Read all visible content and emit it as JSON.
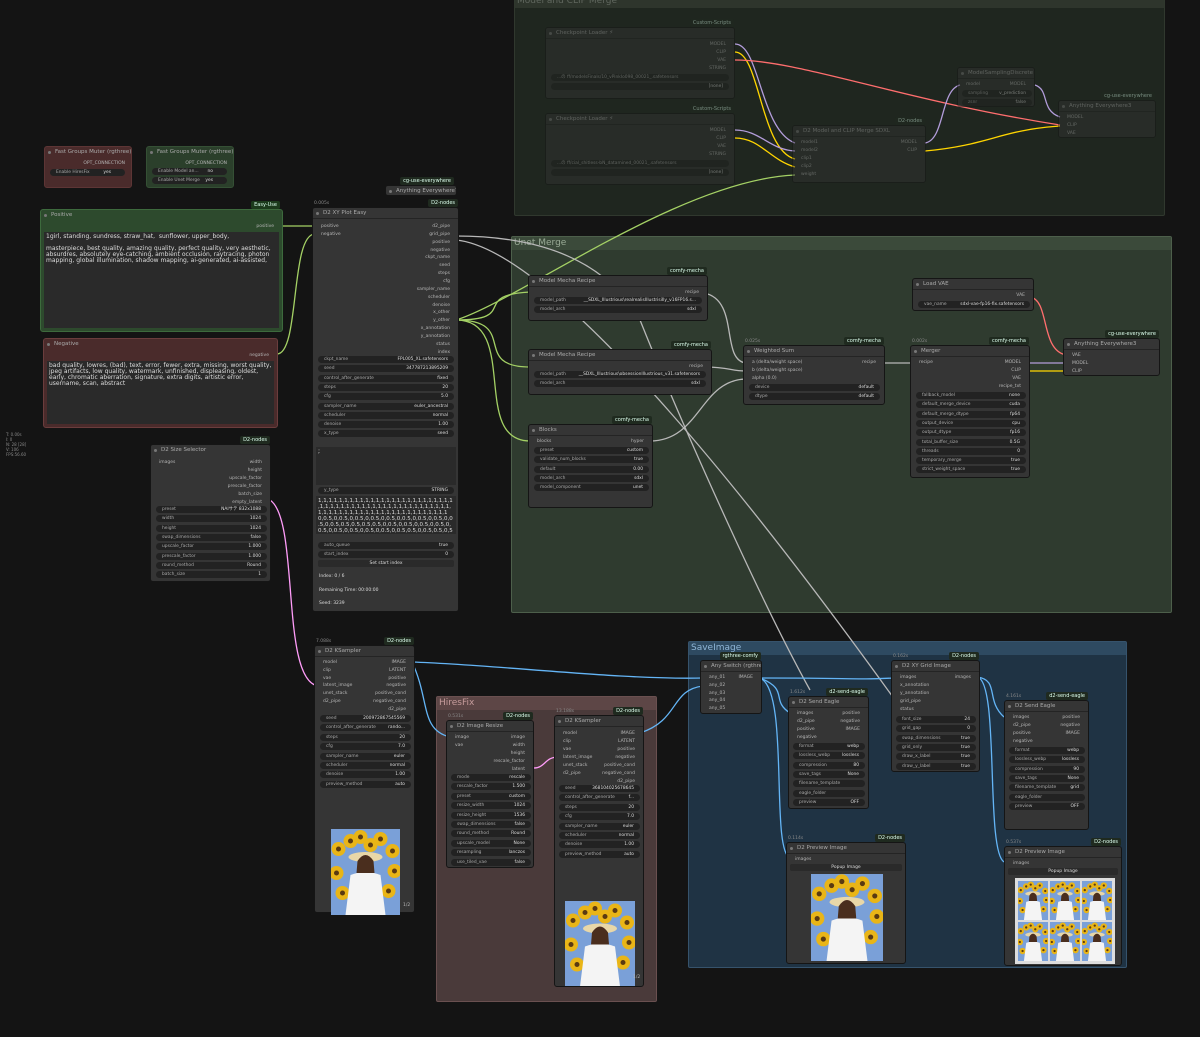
{
  "groups": {
    "merge": "Model and CLIP Merge",
    "unet": "Unet Merge",
    "save": "SaveImage",
    "hires": "HiresFix"
  },
  "info": [
    "T: 0.00s",
    "I: 0",
    "N: 28 [28]",
    "V: 106",
    "FPS:56.60"
  ],
  "muter1": {
    "title": "Fast Groups Muter (rgthree)",
    "opt": "OPT_CONNECTION",
    "row_label": "Enable HiresFix",
    "row_val": "yes"
  },
  "muter2": {
    "title": "Fast Groups Muter (rgthree)",
    "opt": "OPT_CONNECTION",
    "row1_label": "Enable Model an...",
    "row1_val": "no",
    "row2_label": "Enable Unet Merge",
    "row2_val": "yes"
  },
  "positive": {
    "title": "Positive",
    "badge": "Easy-Use",
    "out": "positive",
    "text": "1girl, standing, sundress, straw_hat,  sunflower, upper_body,\n\nmasterpiece, best quality, amazing quality, perfect quality, very aesthetic, absurdres, absolutely eye-catching, ambient occlusion, raytracing, photon mapping, global illumination, shadow mapping, ai-generated, ai-assisted,"
  },
  "negative": {
    "title": "Negative",
    "out": "negative",
    "text": "bad quality, lowres, (bad), text, error, fewer, extra, missing, worst quality, jpeg artifacts, low quality, watermark, unfinished, displeasing, oldest, early, chromatic aberration, signature, extra digits, artistic error, username, scan, abstract"
  },
  "sizesel": {
    "title": "D2 Size Selector",
    "badge": "D2-nodes",
    "in": "images",
    "outs": [
      "width",
      "height",
      "upscale_factor",
      "prescale_factor",
      "batch_size",
      "empty_latent"
    ],
    "widgets": [
      [
        "preset",
        "NAIサテ 832x1088"
      ],
      [
        "width",
        "1024"
      ],
      [
        "height",
        "1024"
      ],
      [
        "swap_dimensions",
        "false"
      ],
      [
        "upscale_factor",
        "1.000"
      ],
      [
        "prescale_factor",
        "1.000"
      ],
      [
        "round_method",
        "Round"
      ],
      [
        "batch_size",
        "1"
      ]
    ]
  },
  "anything1": {
    "title": "Anything Everywhere?",
    "badge": "cg-use-everywhere"
  },
  "xyplot": {
    "title": "D2 XY Plot Easy",
    "badge": "D2-nodes",
    "time": "0.005s",
    "ins": [
      "positive",
      "negative"
    ],
    "outs": [
      "d2_pipe",
      "grid_pipe",
      "positive",
      "negative",
      "ckpt_name",
      "seed",
      "steps",
      "cfg",
      "sampler_name",
      "scheduler",
      "denoise",
      "x_other",
      "y_other",
      "x_annotation",
      "y_annotation",
      "status",
      "index"
    ],
    "widgets": [
      [
        "ckpt_name",
        "FPL005_XL.safetensors"
      ],
      [
        "seed",
        "347787213895209"
      ],
      [
        "control_after_generate",
        "fixed"
      ],
      [
        "steps",
        "20"
      ],
      [
        "cfg",
        "5.0"
      ],
      [
        "sampler_name",
        "euler_ancestral"
      ],
      [
        "scheduler",
        "normal"
      ],
      [
        "denoise",
        "1.00"
      ],
      [
        "x_type",
        "seed"
      ]
    ],
    "x_value": ";",
    "y_type": [
      "y_type",
      "STRING"
    ],
    "y_value": "1,1,1,1,1,1,1,1,1,1,1,1,1,1,1,1,1,1,1,1,1,1,1,1,1,1,1,1,1,1,1,1,1,1,1,1,1,1,1,1,1,1,1,1,1,1,1,1,1,1,1,1,1,1,1,1,1,1,1,1,1,1,1,1,1,1,1,1,1,1,1,1,1,1,1,1\n0,0.5,0,0.5,0,0.5,0,0.5,0,0.5,0,0.5,0,0.5,0,0.5,0,0.5,0,0.5,0.5,0.5,0.5,0.5,0,0.5,0,0.5,0,0.5,0,0.5,0,0.5,0,0.5,0,0.5,0,0.5,0,0.5,0,0.5,0.5,0,0.5,0.5,0,5,0,5,0,5,0,0,0,5,0,0,5,0,0,5,0,0,5,0,0,5,0,3",
    "auto_queue": [
      "auto_queue",
      "true"
    ],
    "start_index": [
      "start_index",
      "0"
    ],
    "set_btn": "Set start index",
    "index": "Index: 0 / 6",
    "remaining": "Remaining Time: 00:00:00",
    "seed_info": "Seed: 3239"
  },
  "ksampler1": {
    "title": "D2 KSampler",
    "badge": "D2-nodes",
    "time": "7.088s",
    "ins": [
      "model",
      "clip",
      "vae",
      "latent_image",
      "unet_stack",
      "d2_pipe"
    ],
    "outs": [
      "IMAGE",
      "LATENT",
      "positive",
      "negative",
      "positive_cond",
      "negative_cond",
      "d2_pipe"
    ],
    "widgets": [
      [
        "seed",
        "200972867545569"
      ],
      [
        "control_after_generate",
        "rando..."
      ],
      [
        "steps",
        "20"
      ],
      [
        "cfg",
        "7.0"
      ],
      [
        "sampler_name",
        "euler"
      ],
      [
        "scheduler",
        "normal"
      ],
      [
        "denoise",
        "1.00"
      ],
      [
        "preview_method",
        "auto"
      ]
    ],
    "pager": "1/2"
  },
  "resize": {
    "title": "D2 Image Resize",
    "badge": "D2-nodes",
    "time": "0.531s",
    "ins": [
      "image",
      "vae"
    ],
    "outs": [
      "image",
      "width",
      "height",
      "rescale_factor",
      "latent"
    ],
    "widgets": [
      [
        "mode",
        "rescale"
      ],
      [
        "rescale_factor",
        "1.500"
      ],
      [
        "preset",
        "custom"
      ],
      [
        "resize_width",
        "1024"
      ],
      [
        "resize_height",
        "1536"
      ],
      [
        "swap_dimensions",
        "false"
      ],
      [
        "round_method",
        "Round"
      ],
      [
        "upscale_model",
        "None"
      ],
      [
        "resampling",
        "lanczos"
      ],
      [
        "use_tiled_vae",
        "false"
      ]
    ]
  },
  "ksampler2": {
    "title": "D2 KSampler",
    "badge": "D2-nodes",
    "time": "13.188s",
    "ins": [
      "model",
      "clip",
      "vae",
      "latent_image",
      "unet_stack",
      "d2_pipe"
    ],
    "outs": [
      "IMAGE",
      "LATENT",
      "positive",
      "negative",
      "positive_cond",
      "negative_cond",
      "d2_pipe"
    ],
    "widgets": [
      [
        "seed",
        "368104025678645"
      ],
      [
        "control_after_generate",
        "f..."
      ],
      [
        "steps",
        "20"
      ],
      [
        "cfg",
        "7.0"
      ],
      [
        "sampler_name",
        "euler"
      ],
      [
        "scheduler",
        "normal"
      ],
      [
        "denoise",
        "1.00"
      ],
      [
        "preview_method",
        "auto"
      ]
    ],
    "pager": "1/2"
  },
  "ckpt1": {
    "title": "Checkpoint Loader ⚡",
    "badge": "Custom-Scripts",
    "outs": [
      "MODEL",
      "CLIP",
      "VAE",
      "STRING"
    ],
    "ckpt": "...の ff/modelsFinals/10_vPinkIo098_00021_.safetensors",
    "extra": "[none]"
  },
  "ckpt2": {
    "title": "Checkpoint Loader ⚡",
    "badge": "Custom-Scripts",
    "outs": [
      "MODEL",
      "CLIP",
      "VAE",
      "STRING"
    ],
    "ckpt": "...の ff/cial_shitless-bN_datamined_00021_.safetensors",
    "extra": "[none]"
  },
  "msd": {
    "title": "ModelSamplingDiscrete",
    "ins": [
      "model"
    ],
    "outs": [
      "MODEL"
    ],
    "w1": [
      "sampling",
      "v_prediction"
    ],
    "w2": [
      "zsnr",
      "false"
    ]
  },
  "d2merge": {
    "title": "D2 Model and CLIP Merge SDXL",
    "badge": "D2-nodes",
    "ins": [
      "model1",
      "model2",
      "clip1",
      "clip2",
      "weight"
    ],
    "outs": [
      "MODEL",
      "CLIP"
    ]
  },
  "anything2": {
    "title": "Anything Everywhere3",
    "badge": "cg-use-everywhere",
    "ins": [
      "MODEL",
      "CLIP",
      "VAE"
    ]
  },
  "mm1": {
    "title": "Model Mecha Recipe",
    "badge": "comfy-mecha",
    "out": "recipe",
    "w": [
      [
        "model_path",
        "__SDXL_Illustrious\\realrealisIllustrisiIly_v16FP16.s..."
      ],
      [
        "model_arch",
        "sdxl"
      ]
    ]
  },
  "mm2": {
    "title": "Model Mecha Recipe",
    "badge": "comfy-mecha",
    "out": "recipe",
    "w": [
      [
        "model_path",
        "__SDXL_Illustrious\\obsessionIllustrious_v31.safetensors"
      ],
      [
        "model_arch",
        "sdxl"
      ]
    ]
  },
  "blocks": {
    "title": "Blocks",
    "badge": "comfy-mecha",
    "in": "blocks",
    "out": "hyper",
    "w": [
      [
        "preset",
        "custom"
      ],
      [
        "validate_num_blocks",
        "true"
      ],
      [
        "default",
        "0.00"
      ],
      [
        "model_arch",
        "sdxl"
      ],
      [
        "model_component",
        "unet"
      ]
    ]
  },
  "wsum": {
    "title": "Weighted Sum",
    "badge": "comfy-mecha",
    "time": "0.025s",
    "ins": [
      "a (delta/weight space)",
      "b (delta/weight space)",
      "alpha (0.0)"
    ],
    "out": "recipe",
    "w": [
      [
        "device",
        "default"
      ],
      [
        "dtype",
        "default"
      ]
    ]
  },
  "vae": {
    "title": "Load VAE",
    "out": "VAE",
    "w": [
      [
        "vae_name",
        "sdxl-vae-fp16-fix.safetensors"
      ]
    ]
  },
  "merger": {
    "title": "Merger",
    "badge": "comfy-mecha",
    "time": "0.002s",
    "in": "recipe",
    "outs": [
      "MODEL",
      "CLIP",
      "VAE",
      "recipe_txt"
    ],
    "w": [
      [
        "fallback_model",
        "none"
      ],
      [
        "default_merge_device",
        "cuda"
      ],
      [
        "default_merge_dtype",
        "fp64"
      ],
      [
        "output_device",
        "cpu"
      ],
      [
        "output_dtype",
        "fp16"
      ],
      [
        "total_buffer_size",
        "0.5G"
      ],
      [
        "threads",
        "0"
      ],
      [
        "temporary_merge",
        "true"
      ],
      [
        "strict_weight_space",
        "true"
      ]
    ]
  },
  "anything3": {
    "title": "Anything Everywhere3",
    "badge": "cg-use-everywhere",
    "ins": [
      "VAE",
      "MODEL",
      "CLIP"
    ]
  },
  "anyswitch": {
    "title": "Any Switch (rgthree)",
    "badge": "rgthree-comfy",
    "ins": [
      "any_01",
      "any_02",
      "any_03",
      "any_04",
      "any_05"
    ],
    "out": "IMAGE"
  },
  "eagle1": {
    "title": "D2 Send Eagle",
    "badge": "d2-send-eagle",
    "time": "1.612s",
    "ins": [
      "images",
      "d2_pipe",
      "positive",
      "negative"
    ],
    "outs": [
      "positive",
      "negative",
      "IMAGE"
    ],
    "w": [
      [
        "format",
        "webp"
      ],
      [
        "lossless_webp",
        "lossless"
      ],
      [
        "compression",
        "80"
      ],
      [
        "save_tags",
        "None"
      ],
      [
        "filename_template",
        ""
      ],
      [
        "eagle_folder",
        ""
      ],
      [
        "preview",
        "OFF"
      ]
    ]
  },
  "grid": {
    "title": "D2 XY Grid Image",
    "badge": "D2-nodes",
    "time": "0.162s",
    "ins": [
      "images",
      "x_annotation",
      "y_annotation",
      "grid_pipe",
      "status"
    ],
    "out": "images",
    "w": [
      [
        "font_size",
        "24"
      ],
      [
        "grid_gap",
        "0"
      ],
      [
        "swap_dimensions",
        "true"
      ],
      [
        "grid_only",
        "true"
      ],
      [
        "draw_x_label",
        "true"
      ],
      [
        "draw_y_label",
        "true"
      ]
    ]
  },
  "eagle2": {
    "title": "D2 Send Eagle",
    "badge": "d2-send-eagle",
    "time": "4.161s",
    "ins": [
      "images",
      "d2_pipe",
      "positive",
      "negative"
    ],
    "outs": [
      "positive",
      "negative",
      "IMAGE"
    ],
    "w": [
      [
        "format",
        "webp"
      ],
      [
        "lossless_webp",
        "lossless"
      ],
      [
        "compression",
        "90"
      ],
      [
        "save_tags",
        "None"
      ],
      [
        "filename_template",
        "grid"
      ],
      [
        "eagle_folder",
        ""
      ],
      [
        "preview",
        "OFF"
      ]
    ]
  },
  "prev1": {
    "title": "D2 Preview Image",
    "badge": "D2-nodes",
    "time": "0.114s",
    "in": "images",
    "btn": "Popup Image"
  },
  "prev2": {
    "title": "D2 Preview Image",
    "badge": "D2-nodes",
    "time": "0.537s",
    "in": "images",
    "btn": "Popup Image"
  },
  "colors": {
    "bg": "#141414",
    "node": "#353535",
    "model_wire": "#b39ddb",
    "clip_wire": "#ffd500",
    "vae_wire": "#ff6e6e",
    "image_wire": "#64b5f6",
    "latent_wire": "#ff9cf9",
    "cond_wire": "#a4d165"
  }
}
